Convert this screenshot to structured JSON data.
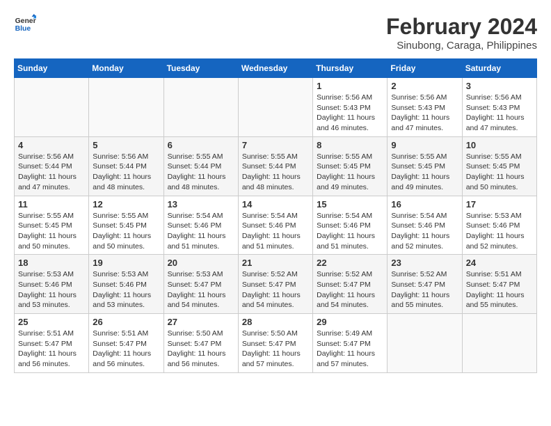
{
  "logo": {
    "line1": "General",
    "line2": "Blue"
  },
  "title": "February 2024",
  "subtitle": "Sinubong, Caraga, Philippines",
  "days_of_week": [
    "Sunday",
    "Monday",
    "Tuesday",
    "Wednesday",
    "Thursday",
    "Friday",
    "Saturday"
  ],
  "weeks": [
    [
      {
        "num": "",
        "info": ""
      },
      {
        "num": "",
        "info": ""
      },
      {
        "num": "",
        "info": ""
      },
      {
        "num": "",
        "info": ""
      },
      {
        "num": "1",
        "info": "Sunrise: 5:56 AM\nSunset: 5:43 PM\nDaylight: 11 hours\nand 46 minutes."
      },
      {
        "num": "2",
        "info": "Sunrise: 5:56 AM\nSunset: 5:43 PM\nDaylight: 11 hours\nand 47 minutes."
      },
      {
        "num": "3",
        "info": "Sunrise: 5:56 AM\nSunset: 5:43 PM\nDaylight: 11 hours\nand 47 minutes."
      }
    ],
    [
      {
        "num": "4",
        "info": "Sunrise: 5:56 AM\nSunset: 5:44 PM\nDaylight: 11 hours\nand 47 minutes."
      },
      {
        "num": "5",
        "info": "Sunrise: 5:56 AM\nSunset: 5:44 PM\nDaylight: 11 hours\nand 48 minutes."
      },
      {
        "num": "6",
        "info": "Sunrise: 5:55 AM\nSunset: 5:44 PM\nDaylight: 11 hours\nand 48 minutes."
      },
      {
        "num": "7",
        "info": "Sunrise: 5:55 AM\nSunset: 5:44 PM\nDaylight: 11 hours\nand 48 minutes."
      },
      {
        "num": "8",
        "info": "Sunrise: 5:55 AM\nSunset: 5:45 PM\nDaylight: 11 hours\nand 49 minutes."
      },
      {
        "num": "9",
        "info": "Sunrise: 5:55 AM\nSunset: 5:45 PM\nDaylight: 11 hours\nand 49 minutes."
      },
      {
        "num": "10",
        "info": "Sunrise: 5:55 AM\nSunset: 5:45 PM\nDaylight: 11 hours\nand 50 minutes."
      }
    ],
    [
      {
        "num": "11",
        "info": "Sunrise: 5:55 AM\nSunset: 5:45 PM\nDaylight: 11 hours\nand 50 minutes."
      },
      {
        "num": "12",
        "info": "Sunrise: 5:55 AM\nSunset: 5:45 PM\nDaylight: 11 hours\nand 50 minutes."
      },
      {
        "num": "13",
        "info": "Sunrise: 5:54 AM\nSunset: 5:46 PM\nDaylight: 11 hours\nand 51 minutes."
      },
      {
        "num": "14",
        "info": "Sunrise: 5:54 AM\nSunset: 5:46 PM\nDaylight: 11 hours\nand 51 minutes."
      },
      {
        "num": "15",
        "info": "Sunrise: 5:54 AM\nSunset: 5:46 PM\nDaylight: 11 hours\nand 51 minutes."
      },
      {
        "num": "16",
        "info": "Sunrise: 5:54 AM\nSunset: 5:46 PM\nDaylight: 11 hours\nand 52 minutes."
      },
      {
        "num": "17",
        "info": "Sunrise: 5:53 AM\nSunset: 5:46 PM\nDaylight: 11 hours\nand 52 minutes."
      }
    ],
    [
      {
        "num": "18",
        "info": "Sunrise: 5:53 AM\nSunset: 5:46 PM\nDaylight: 11 hours\nand 53 minutes."
      },
      {
        "num": "19",
        "info": "Sunrise: 5:53 AM\nSunset: 5:46 PM\nDaylight: 11 hours\nand 53 minutes."
      },
      {
        "num": "20",
        "info": "Sunrise: 5:53 AM\nSunset: 5:47 PM\nDaylight: 11 hours\nand 54 minutes."
      },
      {
        "num": "21",
        "info": "Sunrise: 5:52 AM\nSunset: 5:47 PM\nDaylight: 11 hours\nand 54 minutes."
      },
      {
        "num": "22",
        "info": "Sunrise: 5:52 AM\nSunset: 5:47 PM\nDaylight: 11 hours\nand 54 minutes."
      },
      {
        "num": "23",
        "info": "Sunrise: 5:52 AM\nSunset: 5:47 PM\nDaylight: 11 hours\nand 55 minutes."
      },
      {
        "num": "24",
        "info": "Sunrise: 5:51 AM\nSunset: 5:47 PM\nDaylight: 11 hours\nand 55 minutes."
      }
    ],
    [
      {
        "num": "25",
        "info": "Sunrise: 5:51 AM\nSunset: 5:47 PM\nDaylight: 11 hours\nand 56 minutes."
      },
      {
        "num": "26",
        "info": "Sunrise: 5:51 AM\nSunset: 5:47 PM\nDaylight: 11 hours\nand 56 minutes."
      },
      {
        "num": "27",
        "info": "Sunrise: 5:50 AM\nSunset: 5:47 PM\nDaylight: 11 hours\nand 56 minutes."
      },
      {
        "num": "28",
        "info": "Sunrise: 5:50 AM\nSunset: 5:47 PM\nDaylight: 11 hours\nand 57 minutes."
      },
      {
        "num": "29",
        "info": "Sunrise: 5:49 AM\nSunset: 5:47 PM\nDaylight: 11 hours\nand 57 minutes."
      },
      {
        "num": "",
        "info": ""
      },
      {
        "num": "",
        "info": ""
      }
    ]
  ]
}
